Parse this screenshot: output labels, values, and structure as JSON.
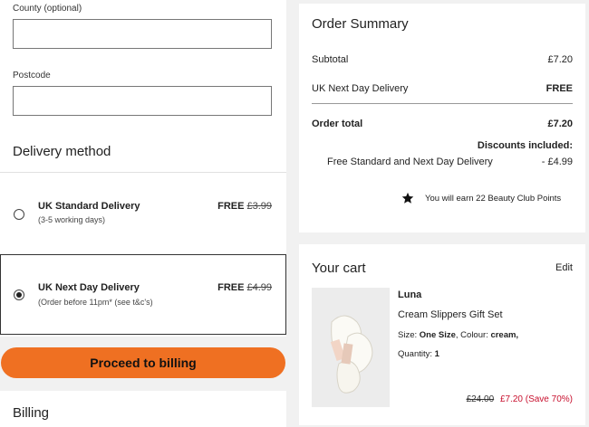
{
  "address": {
    "county_label": "County (optional)",
    "county_value": "",
    "postcode_label": "Postcode",
    "postcode_value": ""
  },
  "delivery": {
    "title": "Delivery method",
    "options": [
      {
        "name": "UK Standard Delivery",
        "sub": "(3-5 working days)",
        "price_now": "FREE",
        "price_was": "£3.99",
        "selected": false
      },
      {
        "name": "UK Next Day Delivery",
        "sub": "(Order before 11pm* (see t&c's)",
        "price_now": "FREE",
        "price_was": "£4.99",
        "selected": true
      }
    ],
    "proceed_label": "Proceed to billing"
  },
  "billing": {
    "title": "Billing"
  },
  "summary": {
    "title": "Order Summary",
    "subtotal_label": "Subtotal",
    "subtotal_value": "£7.20",
    "delivery_label": "UK Next Day Delivery",
    "delivery_value": "FREE",
    "total_label": "Order total",
    "total_value": "£7.20",
    "discounts_label": "Discounts included:",
    "discount_name": "Free Standard and Next Day Delivery",
    "discount_value": "- £4.99",
    "points_text": "You will earn 22 Beauty Club Points",
    "icon": "star-icon"
  },
  "cart": {
    "title": "Your cart",
    "edit_label": "Edit",
    "item": {
      "brand": "Luna",
      "name": "Cream Slippers Gift Set",
      "size_label": "Size:",
      "size_value": "One Size",
      "colour_label": "Colour:",
      "colour_value": "cream,",
      "qty_label": "Quantity:",
      "qty_value": "1",
      "was_price": "£24.00",
      "now_price": "£7.20",
      "saving": "(Save 70%)"
    }
  },
  "colors": {
    "accent_button": "#ef7022",
    "sale_red": "#c8102e",
    "page_bg": "#f1f1f1"
  }
}
